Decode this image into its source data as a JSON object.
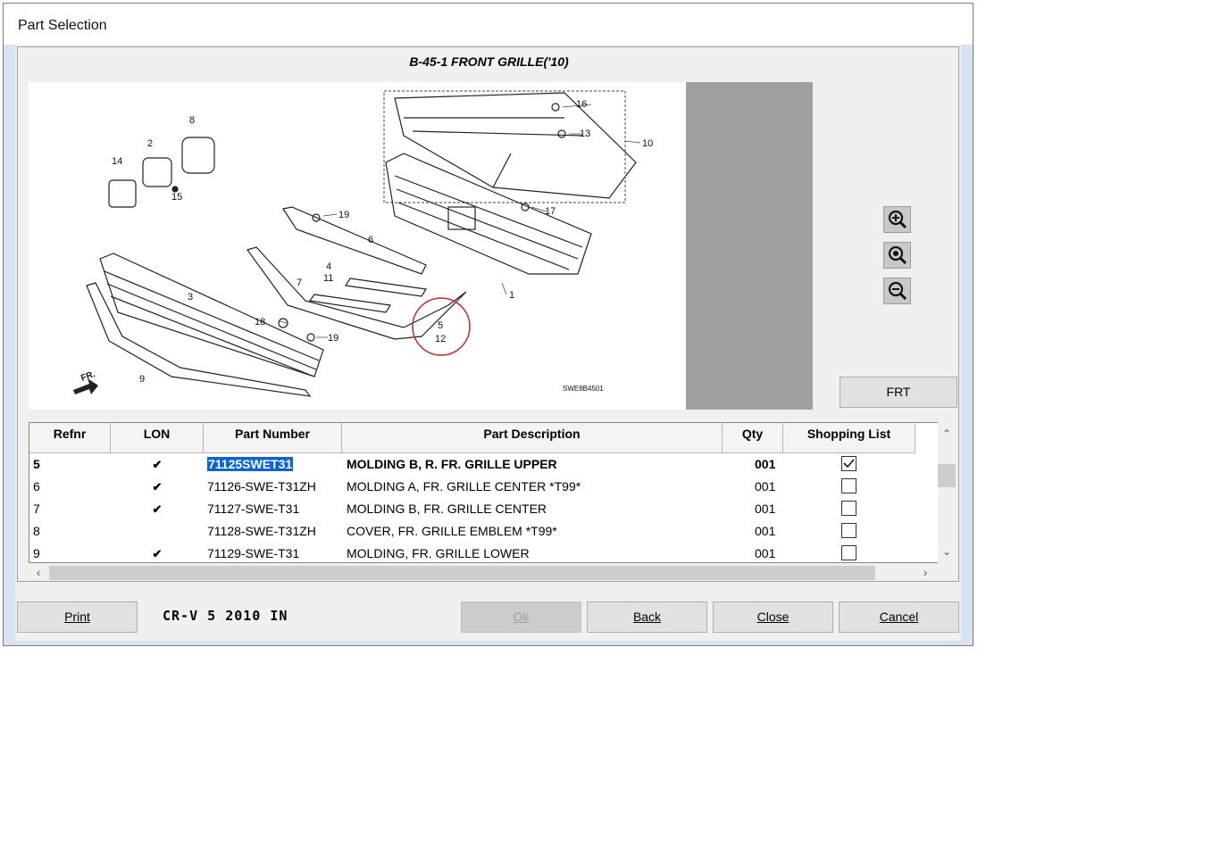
{
  "window": {
    "title": "Part Selection"
  },
  "figure": {
    "title": "B-45-1 FRONT GRILLE('10)",
    "code": "SWE8B4501",
    "callouts": [
      "1",
      "2",
      "3",
      "4",
      "5",
      "6",
      "7",
      "8",
      "9",
      "10",
      "11",
      "12",
      "13",
      "14",
      "15",
      "16",
      "17",
      "18",
      "19",
      "19"
    ],
    "direction_label": "FR."
  },
  "zoom": {
    "in": "zoom-in-icon",
    "fit": "zoom-fit-icon",
    "out": "zoom-out-icon"
  },
  "frt_label": "FRT",
  "table": {
    "headers": [
      "Refnr",
      "LON",
      "Part Number",
      "Part Description",
      "Qty",
      "Shopping List"
    ],
    "rows": [
      {
        "ref": "5",
        "lon": "✔",
        "part": "71125SWET31",
        "desc": "MOLDING B, R. FR. GRILLE UPPER",
        "qty": "001",
        "checked": true
      },
      {
        "ref": "6",
        "lon": "✔",
        "part": "71126-SWE-T31ZH",
        "desc": "MOLDING A, FR. GRILLE CENTER *T99*",
        "qty": "001",
        "checked": false
      },
      {
        "ref": "7",
        "lon": "✔",
        "part": "71127-SWE-T31",
        "desc": "MOLDING B, FR. GRILLE CENTER",
        "qty": "001",
        "checked": false
      },
      {
        "ref": "8",
        "lon": "",
        "part": "71128-SWE-T31ZH",
        "desc": "COVER, FR. GRILLE EMBLEM *T99*",
        "qty": "001",
        "checked": false
      },
      {
        "ref": "9",
        "lon": "✔",
        "part": "71129-SWE-T31",
        "desc": "MOLDING, FR. GRILLE LOWER",
        "qty": "001",
        "checked": false
      }
    ]
  },
  "footer": {
    "print": "Print",
    "model": "CR-V  5  2010  IN",
    "ok": "Ok",
    "back": "Back",
    "close": "Close",
    "cancel": "Cancel"
  },
  "colors": {
    "selection": "#0a64d8",
    "highlight_circle": "#c0282d",
    "diagram_bg": "#a0a0a0"
  }
}
